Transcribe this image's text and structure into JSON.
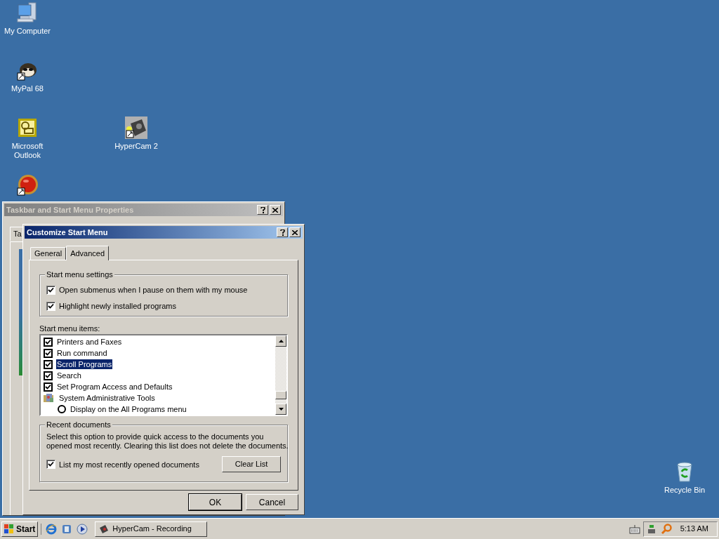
{
  "desktop_icons": [
    {
      "kind": "computer",
      "label": "My Computer"
    },
    {
      "kind": "raccoon",
      "label": "MyPal 68"
    },
    {
      "kind": "outlook",
      "label": "Microsoft Outlook"
    },
    {
      "kind": "camera",
      "label": "HyperCam 2"
    },
    {
      "kind": "redball"
    },
    {
      "kind": "recycle",
      "label": "Recycle Bin"
    }
  ],
  "back_window": {
    "title": "Taskbar and Start Menu Properties",
    "active": false,
    "tab": "Ta"
  },
  "dialog": {
    "title": "Customize Start Menu",
    "active": true,
    "tabs": [
      {
        "label": "General",
        "selected": false
      },
      {
        "label": "Advanced",
        "selected": true
      }
    ],
    "settings_group": {
      "title": "Start menu settings",
      "options": [
        {
          "label": "Open submenus when I pause on them with my mouse",
          "checked": true
        },
        {
          "label": "Highlight newly installed programs",
          "checked": true
        }
      ]
    },
    "items_label": "Start menu items:",
    "items": [
      {
        "kind": "checkbox",
        "label": "Printers and Faxes",
        "checked": true,
        "selected": false
      },
      {
        "kind": "checkbox",
        "label": "Run command",
        "checked": true,
        "selected": false
      },
      {
        "kind": "checkbox",
        "label": "Scroll Programs",
        "checked": true,
        "selected": true
      },
      {
        "kind": "checkbox",
        "label": "Search",
        "checked": true,
        "selected": false
      },
      {
        "kind": "checkbox",
        "label": "Set Program Access and Defaults",
        "checked": true,
        "selected": false
      },
      {
        "kind": "folder",
        "label": "System Administrative Tools",
        "selected": false,
        "children": [
          {
            "kind": "radio",
            "label": "Display on the All Programs menu",
            "checked": false,
            "selected": false
          }
        ]
      }
    ],
    "recent_group": {
      "title": "Recent documents",
      "description": "Select this option to provide quick access to the documents you opened most recently.  Clearing this list does not delete the documents.",
      "option": {
        "label": "List my most recently opened documents",
        "checked": true
      },
      "clear_button": "Clear List"
    },
    "buttons": [
      "OK",
      "Cancel"
    ]
  },
  "taskbar": {
    "start": "Start",
    "task": {
      "label": "HyperCam - Recording",
      "selected": false
    },
    "clock": "5:13 AM"
  }
}
